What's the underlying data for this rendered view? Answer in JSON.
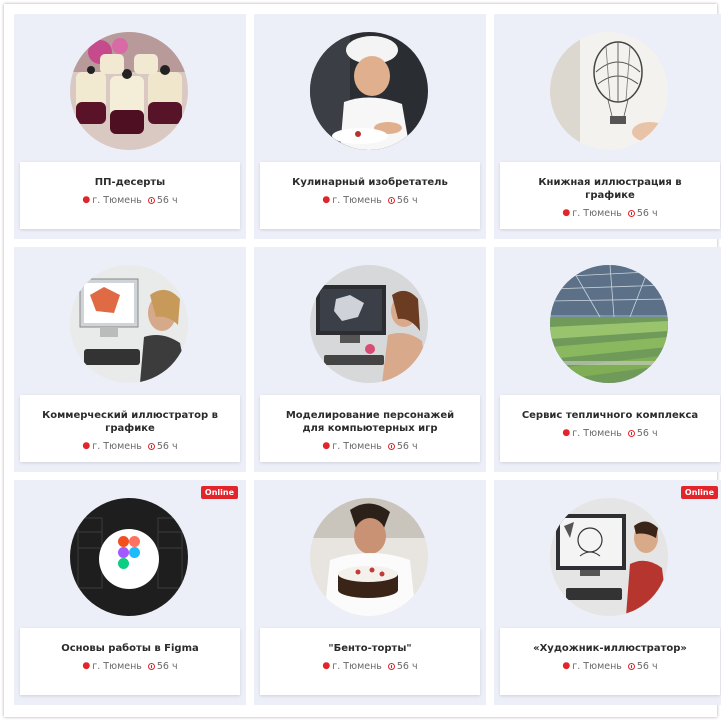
{
  "cards": [
    {
      "title": "ПП-десерты",
      "city": "г. Тюмень",
      "duration": "56 ч",
      "badge": "",
      "image_icon": "desserts-photo"
    },
    {
      "title": "Кулинарный изобретатель",
      "city": "г. Тюмень",
      "duration": "56 ч",
      "badge": "",
      "image_icon": "chef-photo"
    },
    {
      "title": "Книжная иллюстрация в графике",
      "city": "г. Тюмень",
      "duration": "56 ч",
      "badge": "",
      "image_icon": "balloon-sketch-photo"
    },
    {
      "title": "Коммерческий иллюстратор в графике",
      "city": "г. Тюмень",
      "duration": "56 ч",
      "badge": "",
      "image_icon": "graphic-tablet-photo"
    },
    {
      "title": "Моделирование персонажей для компьютерных игр",
      "city": "г. Тюмень",
      "duration": "56 ч",
      "badge": "",
      "image_icon": "3d-modeling-photo"
    },
    {
      "title": "Сервис тепличного комплекса",
      "city": "г. Тюмень",
      "duration": "56 ч",
      "badge": "",
      "image_icon": "greenhouse-photo"
    },
    {
      "title": "Основы работы в Figma",
      "city": "г. Тюмень",
      "duration": "56 ч",
      "badge": "Online",
      "image_icon": "figma-logo"
    },
    {
      "title": "\"Бенто-торты\"",
      "city": "г. Тюмень",
      "duration": "56 ч",
      "badge": "",
      "image_icon": "cake-chef-photo"
    },
    {
      "title": "«Художник-иллюстратор»",
      "city": "г. Тюмень",
      "duration": "56 ч",
      "badge": "Online",
      "image_icon": "illustrator-photo"
    }
  ],
  "colors": {
    "accent": "#e2242b",
    "card_bg": "#eceef8"
  }
}
